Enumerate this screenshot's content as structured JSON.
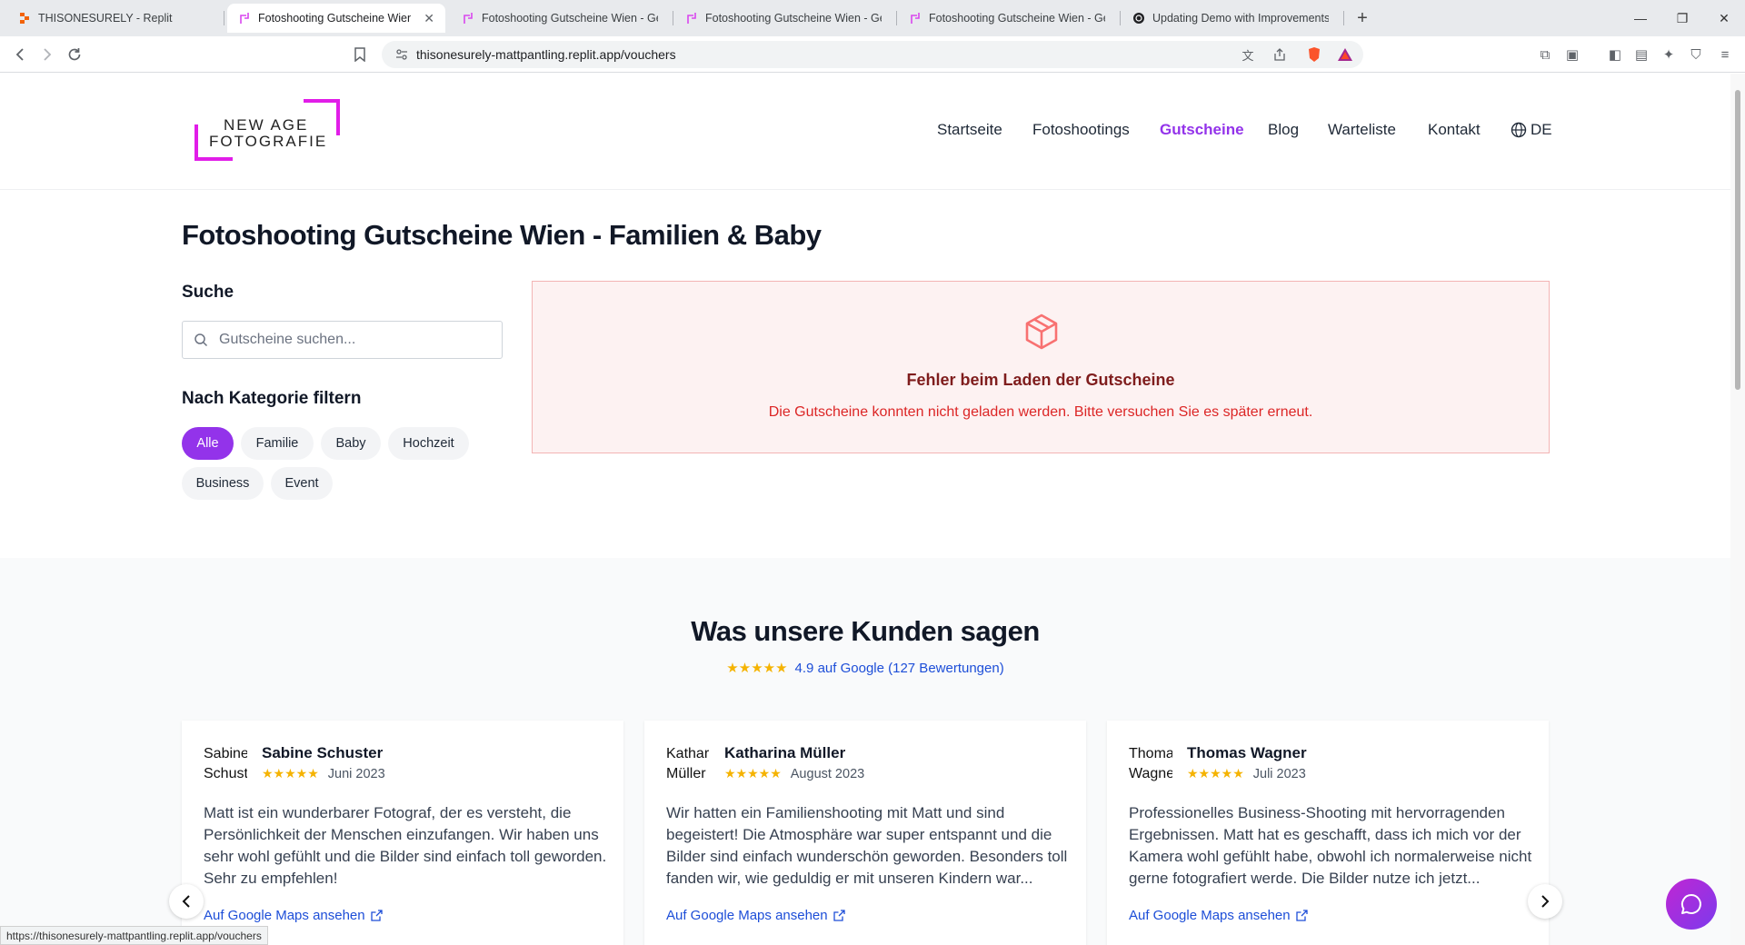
{
  "browser": {
    "tabs": [
      {
        "title": "THISONESURELY - Replit",
        "icon": "replit-icon"
      },
      {
        "title": "Fotoshooting Gutscheine Wien - ",
        "icon": "site-icon",
        "active": true
      },
      {
        "title": "Fotoshooting Gutscheine Wien - Ges",
        "icon": "site-icon"
      },
      {
        "title": "Fotoshooting Gutscheine Wien - Ges",
        "icon": "site-icon"
      },
      {
        "title": "Fotoshooting Gutscheine Wien - Ges",
        "icon": "site-icon"
      },
      {
        "title": "Updating Demo with Improvements",
        "icon": "openai-icon"
      }
    ],
    "url": "thisonesurely-mattpantling.replit.app/vouchers",
    "status_url": "https://thisonesurely-mattpantling.replit.app/vouchers"
  },
  "header": {
    "logo_line1": "NEW AGE",
    "logo_line2": "FOTOGRAFIE",
    "nav": [
      "Startseite",
      "Fotoshootings",
      "Gutscheine",
      "Blog",
      "Warteliste",
      "Kontakt"
    ],
    "active_nav": "Gutscheine",
    "language": "DE"
  },
  "main": {
    "title": "Fotoshooting Gutscheine Wien - Familien & Baby",
    "search_label": "Suche",
    "search_placeholder": "Gutscheine suchen...",
    "filter_label": "Nach Kategorie filtern",
    "categories": [
      "Alle",
      "Familie",
      "Baby",
      "Hochzeit",
      "Business",
      "Event"
    ],
    "active_category": "Alle",
    "error_title": "Fehler beim Laden der Gutscheine",
    "error_message": "Die Gutscheine konnten nicht geladen werden. Bitte versuchen Sie es später erneut."
  },
  "reviews": {
    "title": "Was unsere Kunden sagen",
    "stars": "★★★★★",
    "summary": "4.9 auf Google (127 Bewertungen)",
    "items": [
      {
        "avatar_alt": "Sabine Schuster",
        "name": "Sabine Schuster",
        "date": "Juni 2023",
        "text": "Matt ist ein wunderbarer Fotograf, der es versteht, die Persönlichkeit der Menschen einzufangen. Wir haben uns sehr wohl gefühlt und die Bilder sind einfach toll geworden. Sehr zu empfehlen!",
        "link": "Auf Google Maps ansehen"
      },
      {
        "avatar_alt": "Katharina Müller",
        "name": "Katharina Müller",
        "date": "August 2023",
        "text": "Wir hatten ein Familienshooting mit Matt und sind begeistert! Die Atmosphäre war super entspannt und die Bilder sind einfach wunderschön geworden. Besonders toll fanden wir, wie geduldig er mit unseren Kindern war...",
        "link": "Auf Google Maps ansehen"
      },
      {
        "avatar_alt": "Thomas Wagner",
        "name": "Thomas Wagner",
        "date": "Juli 2023",
        "text": "Professionelles Business-Shooting mit hervorragenden Ergebnissen. Matt hat es geschafft, dass ich mich vor der Kamera wohl gefühlt habe, obwohl ich normalerweise nicht gerne fotografiert werde. Die Bilder nutze ich jetzt...",
        "link": "Auf Google Maps ansehen"
      }
    ]
  },
  "colors": {
    "accent": "#9333ea",
    "logo": "#e11de8",
    "error_bg": "#fdf2f2",
    "error_text": "#dc2626",
    "star": "#f5b301",
    "link": "#1d4ed8"
  }
}
